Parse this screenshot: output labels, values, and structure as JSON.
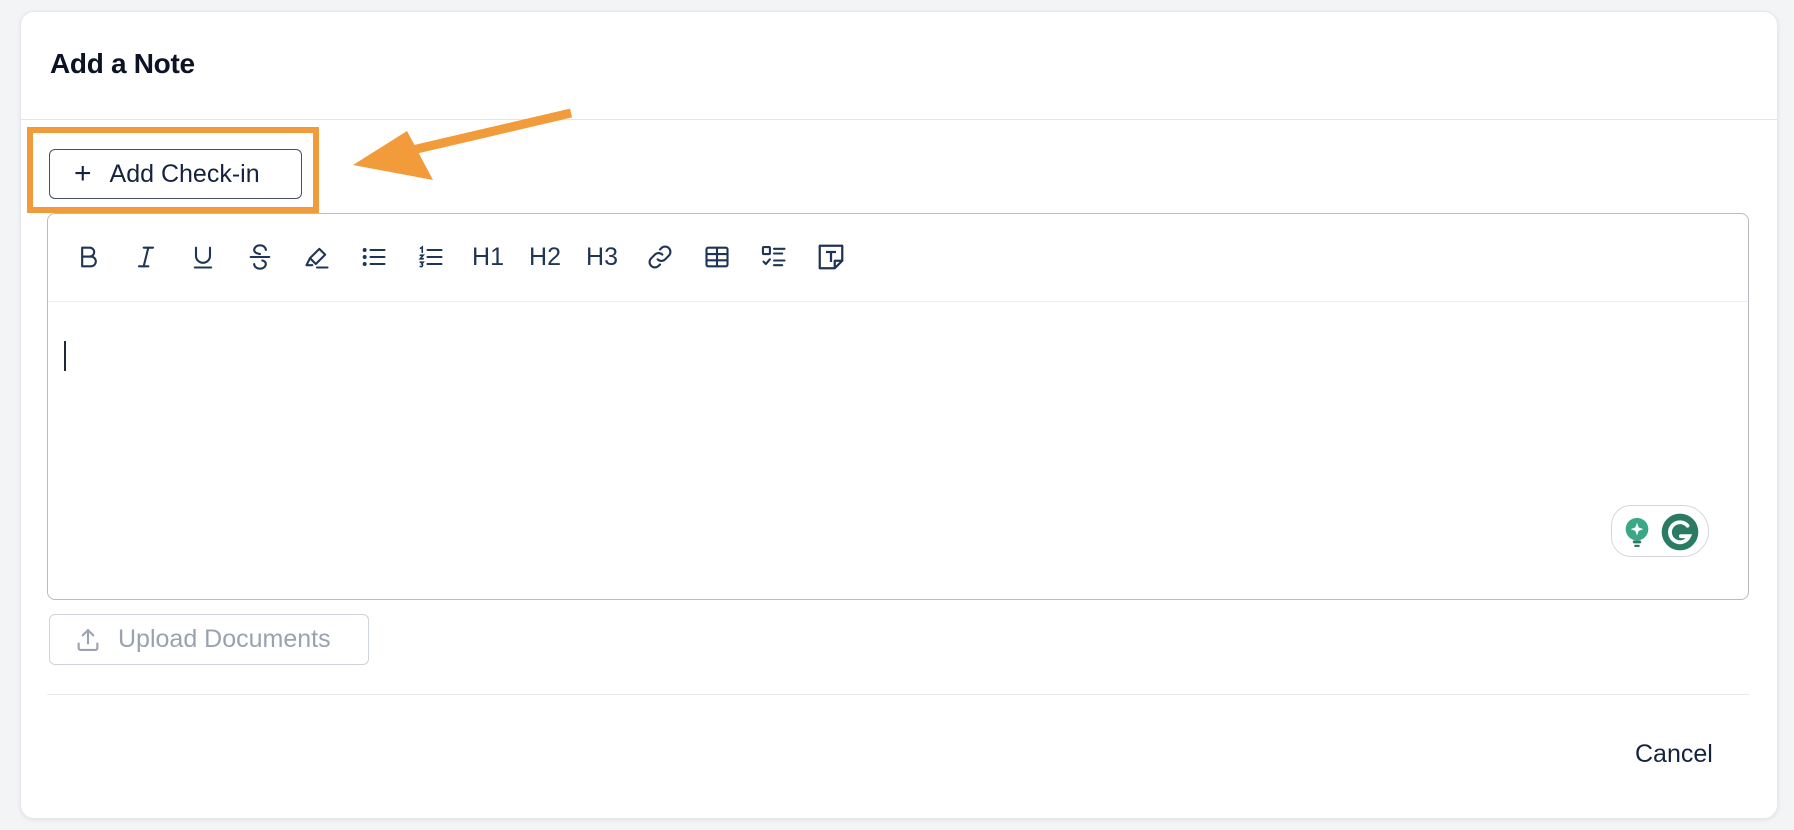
{
  "dialog": {
    "title": "Add a Note"
  },
  "checkin_button": {
    "label": "Add Check-in",
    "icon": "plus-icon"
  },
  "annotation": {
    "highlight_color": "#f29b3b",
    "arrow": "arrow-pointing-left"
  },
  "toolbar": {
    "items": [
      {
        "name": "bold",
        "icon": "bold-icon"
      },
      {
        "name": "italic",
        "icon": "italic-icon"
      },
      {
        "name": "underline",
        "icon": "underline-icon"
      },
      {
        "name": "strikethrough",
        "icon": "strikethrough-icon"
      },
      {
        "name": "highlight",
        "icon": "highlighter-icon"
      },
      {
        "name": "bullet-list",
        "icon": "bullet-list-icon"
      },
      {
        "name": "numbered-list",
        "icon": "numbered-list-icon"
      },
      {
        "name": "h1",
        "label": "H1"
      },
      {
        "name": "h2",
        "label": "H2"
      },
      {
        "name": "h3",
        "label": "H3"
      },
      {
        "name": "link",
        "icon": "link-icon"
      },
      {
        "name": "table",
        "icon": "table-icon"
      },
      {
        "name": "checklist",
        "icon": "checklist-icon"
      },
      {
        "name": "text-template",
        "icon": "text-box-icon"
      }
    ]
  },
  "editor": {
    "value": ""
  },
  "grammarly": {
    "icons": [
      "lightbulb-icon",
      "grammarly-g-icon"
    ],
    "color": "#2b7a63"
  },
  "upload_button": {
    "label": "Upload Documents",
    "icon": "upload-icon"
  },
  "footer": {
    "cancel_label": "Cancel"
  },
  "colors": {
    "accent_orange": "#f29b3b",
    "text_dark": "#16233f",
    "icon_navy": "#1f3556",
    "muted": "#9aa2b0",
    "grammarly_green": "#2b7a63"
  }
}
